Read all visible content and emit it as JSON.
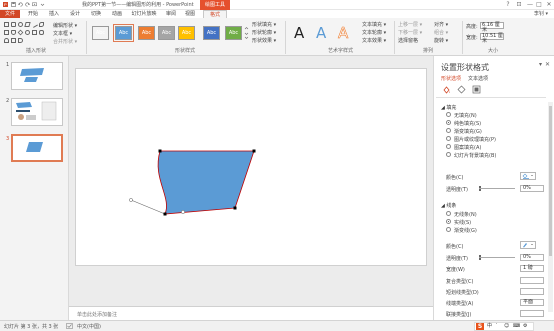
{
  "titlebar": {
    "title": "我的PPT第一节——编辑图形的利用 - PowerPoint",
    "context_tab": "绘图工具",
    "min": "—",
    "max": "□",
    "close": "✕",
    "help": "?",
    "ribbon_opts": "⊡"
  },
  "tabs": [
    {
      "label": "文件"
    },
    {
      "label": "开始"
    },
    {
      "label": "插入"
    },
    {
      "label": "设计"
    },
    {
      "label": "切换"
    },
    {
      "label": "动画"
    },
    {
      "label": "幻灯片放映"
    },
    {
      "label": "审阅"
    },
    {
      "label": "视图"
    },
    {
      "label": "格式"
    }
  ],
  "user": "李钊 ▾",
  "ribbon": {
    "insert_shapes": {
      "edit_shape": "编辑形状 ▾",
      "text_box": "文本框 ▾",
      "merge_shapes": "合并形状 ▾",
      "label": "插入形状"
    },
    "shape_styles": {
      "swatches": [
        {
          "text": "Abc",
          "color": "#111111"
        },
        {
          "text": "Abc",
          "color": "#5b9bd5"
        },
        {
          "text": "Abc",
          "color": "#ed7d31"
        },
        {
          "text": "Abc",
          "color": "#a5a5a5"
        },
        {
          "text": "Abc",
          "color": "#ffc000"
        },
        {
          "text": "Abc",
          "color": "#4472c4"
        },
        {
          "text": "Abc",
          "color": "#70ad47"
        }
      ],
      "fill": "形状填充 ▾",
      "outline": "形状轮廓 ▾",
      "effects": "形状效果 ▾",
      "label": "形状样式"
    },
    "wordart": {
      "letters": [
        "A",
        "A",
        "A"
      ],
      "text_fill": "文本填充 ▾",
      "text_outline": "文本轮廓 ▾",
      "text_effects": "文本效果 ▾",
      "label": "艺术字样式"
    },
    "arrange": {
      "bring_forward": "上移一层 ▾",
      "send_backward": "下移一层 ▾",
      "selection_pane": "选择窗格",
      "align": "对齐 ▾",
      "group": "组合 ▾",
      "rotate": "旋转 ▾",
      "label": "排列"
    },
    "size": {
      "height_label": "高度:",
      "height_value": "6.16 厘米",
      "width_label": "宽度:",
      "width_value": "10.51 厘米",
      "label": "大小"
    }
  },
  "thumbnails": [
    {
      "num": "1"
    },
    {
      "num": "2"
    },
    {
      "num": "3"
    }
  ],
  "notes_placeholder": "单击此处添加备注",
  "pane": {
    "title": "设置形状格式",
    "close": "✕",
    "pin": "▾",
    "tabs": [
      "形状选项",
      "文本选项"
    ],
    "fill": {
      "heading": "◢ 填充",
      "options": [
        {
          "label": "无填充(N)",
          "on": false
        },
        {
          "label": "纯色填充(S)",
          "on": true
        },
        {
          "label": "渐变填充(G)",
          "on": false
        },
        {
          "label": "图片或纹理填充(P)",
          "on": false
        },
        {
          "label": "图案填充(A)",
          "on": false
        },
        {
          "label": "幻灯片背景填充(B)",
          "on": false
        }
      ],
      "color_label": "颜色(C)",
      "transparency_label": "透明度(T)",
      "transparency_value": "0%"
    },
    "line": {
      "heading": "◢ 线条",
      "options": [
        {
          "label": "无线条(N)",
          "on": false
        },
        {
          "label": "实线(S)",
          "on": true
        },
        {
          "label": "渐变线(G)",
          "on": false
        }
      ],
      "color_label": "颜色(C)",
      "transparency_label": "透明度(T)",
      "transparency_value": "0%",
      "width_label": "宽度(W)",
      "width_value": "1 磅",
      "compound_label": "复合类型(C)",
      "dash_label": "短划线类型(D)",
      "cap_label": "线端类型(A)",
      "cap_value": "平面",
      "join_label": "联接类型(J)"
    }
  },
  "status": {
    "slide_info": "幻灯片 第 3 张，共 3 张",
    "language": "中文(中国)",
    "sogou": {
      "mode": "中",
      "items": [
        "′",
        "☺",
        "⌨",
        "⚙"
      ]
    }
  },
  "colors": {
    "accent": "#d24726",
    "shape_fill": "#5b9bd5",
    "shape_outline": "#c00000"
  }
}
